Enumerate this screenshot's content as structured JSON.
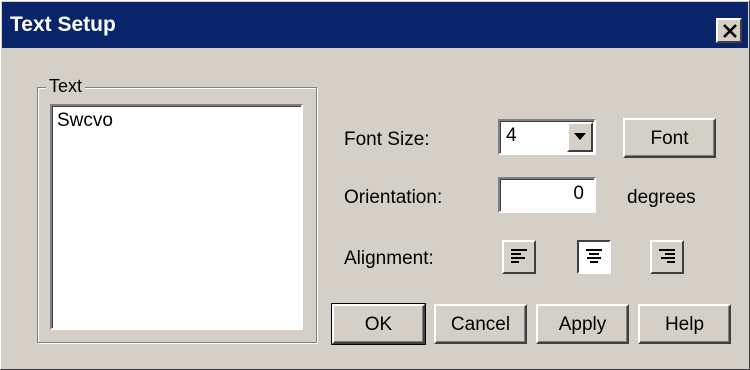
{
  "window": {
    "title": "Text Setup",
    "close_label": "Close"
  },
  "text_group": {
    "label": "Text",
    "content": "Swcvo"
  },
  "font_size": {
    "label": "Font Size:",
    "value": "4",
    "font_button": "Font"
  },
  "orientation": {
    "label": "Orientation:",
    "value": "0",
    "unit": "degrees"
  },
  "alignment": {
    "label": "Alignment:",
    "options": [
      "left",
      "center",
      "right"
    ],
    "selected": "center"
  },
  "buttons": {
    "ok": "OK",
    "cancel": "Cancel",
    "apply": "Apply",
    "help": "Help"
  },
  "colors": {
    "titlebar": "#0a246a",
    "face": "#d4d0c8"
  }
}
